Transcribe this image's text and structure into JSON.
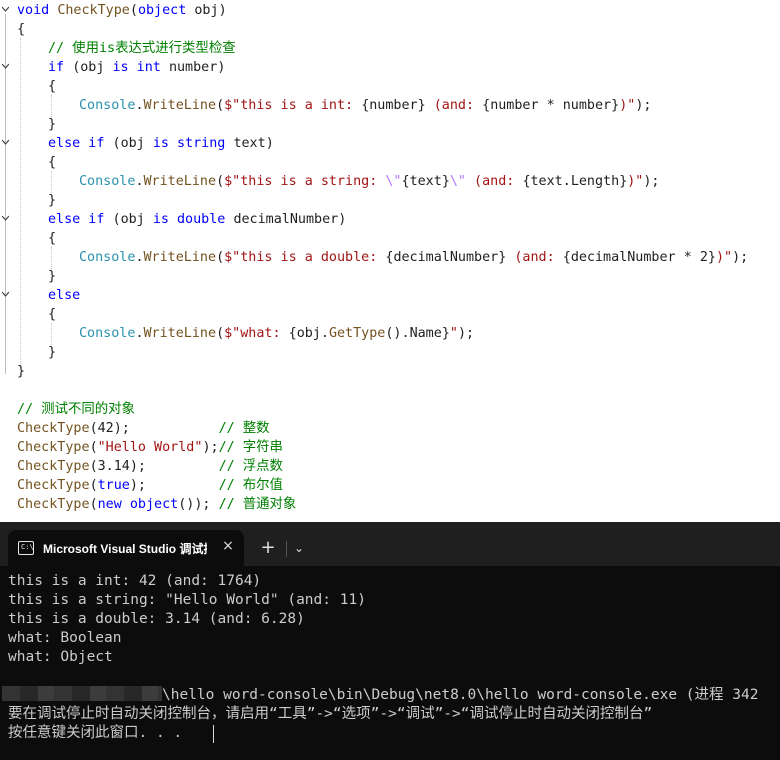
{
  "editor": {
    "lines": [
      [
        [
          "kw",
          "void "
        ],
        [
          "mth",
          "CheckType"
        ],
        [
          "pu",
          "("
        ],
        [
          "kw",
          "object "
        ],
        [
          "id",
          "obj"
        ],
        [
          "pu",
          ")"
        ]
      ],
      [
        [
          "pu",
          "{"
        ]
      ],
      [
        [
          "cm",
          "// 使用is表达式进行类型检查"
        ]
      ],
      [
        [
          "kw",
          "if "
        ],
        [
          "pu",
          "("
        ],
        [
          "id",
          "obj "
        ],
        [
          "kw",
          "is int "
        ],
        [
          "id",
          "number"
        ],
        [
          "pu",
          ")"
        ]
      ],
      [
        [
          "pu",
          "{"
        ]
      ],
      [
        [
          "ty",
          "Console"
        ],
        [
          "pu",
          "."
        ],
        [
          "mth",
          "WriteLine"
        ],
        [
          "pu",
          "("
        ],
        [
          "str",
          "$\"this is a int: "
        ],
        [
          "pu",
          "{"
        ],
        [
          "id",
          "number"
        ],
        [
          "pu",
          "}"
        ],
        [
          "str",
          " (and: "
        ],
        [
          "pu",
          "{"
        ],
        [
          "id",
          "number "
        ],
        [
          "pu",
          "* "
        ],
        [
          "id",
          "number"
        ],
        [
          "pu",
          "}"
        ],
        [
          "str",
          ")\""
        ],
        [
          "pu",
          ");"
        ]
      ],
      [
        [
          "pu",
          "}"
        ]
      ],
      [
        [
          "kw",
          "else if "
        ],
        [
          "pu",
          "("
        ],
        [
          "id",
          "obj "
        ],
        [
          "kw",
          "is string "
        ],
        [
          "id",
          "text"
        ],
        [
          "pu",
          ")"
        ]
      ],
      [
        [
          "pu",
          "{"
        ]
      ],
      [
        [
          "ty",
          "Console"
        ],
        [
          "pu",
          "."
        ],
        [
          "mth",
          "WriteLine"
        ],
        [
          "pu",
          "("
        ],
        [
          "str",
          "$\"this is a string: "
        ],
        [
          "esc",
          "\\\""
        ],
        [
          "pu",
          "{"
        ],
        [
          "id",
          "text"
        ],
        [
          "pu",
          "}"
        ],
        [
          "esc",
          "\\\""
        ],
        [
          "str",
          " (and: "
        ],
        [
          "pu",
          "{"
        ],
        [
          "id",
          "text"
        ],
        [
          "pu",
          "."
        ],
        [
          "id",
          "Length"
        ],
        [
          "pu",
          "}"
        ],
        [
          "str",
          ")\""
        ],
        [
          "pu",
          ");"
        ]
      ],
      [
        [
          "pu",
          "}"
        ]
      ],
      [
        [
          "kw",
          "else if "
        ],
        [
          "pu",
          "("
        ],
        [
          "id",
          "obj "
        ],
        [
          "kw",
          "is double "
        ],
        [
          "id",
          "decimalNumber"
        ],
        [
          "pu",
          ")"
        ]
      ],
      [
        [
          "pu",
          "{"
        ]
      ],
      [
        [
          "ty",
          "Console"
        ],
        [
          "pu",
          "."
        ],
        [
          "mth",
          "WriteLine"
        ],
        [
          "pu",
          "("
        ],
        [
          "str",
          "$\"this is a double: "
        ],
        [
          "pu",
          "{"
        ],
        [
          "id",
          "decimalNumber"
        ],
        [
          "pu",
          "}"
        ],
        [
          "str",
          " (and: "
        ],
        [
          "pu",
          "{"
        ],
        [
          "id",
          "decimalNumber "
        ],
        [
          "pu",
          "* "
        ],
        [
          "id",
          "2"
        ],
        [
          "pu",
          "}"
        ],
        [
          "str",
          ")\""
        ],
        [
          "pu",
          ");"
        ]
      ],
      [
        [
          "pu",
          "}"
        ]
      ],
      [
        [
          "kw",
          "else"
        ]
      ],
      [
        [
          "pu",
          "{"
        ]
      ],
      [
        [
          "ty",
          "Console"
        ],
        [
          "pu",
          "."
        ],
        [
          "mth",
          "WriteLine"
        ],
        [
          "pu",
          "("
        ],
        [
          "str",
          "$\"what: "
        ],
        [
          "pu",
          "{"
        ],
        [
          "id",
          "obj"
        ],
        [
          "pu",
          "."
        ],
        [
          "mth",
          "GetType"
        ],
        [
          "pu",
          "()."
        ],
        [
          "id",
          "Name"
        ],
        [
          "pu",
          "}"
        ],
        [
          "str",
          "\""
        ],
        [
          "pu",
          ");"
        ]
      ],
      [
        [
          "pu",
          "}"
        ]
      ],
      [
        [
          "pu",
          "}"
        ]
      ],
      [],
      [
        [
          "cm",
          "// 测试不同的对象"
        ]
      ],
      [
        [
          "mth",
          "CheckType"
        ],
        [
          "pu",
          "("
        ],
        [
          "id",
          "42"
        ],
        [
          "pu",
          ");           "
        ],
        [
          "cm",
          "// 整数"
        ]
      ],
      [
        [
          "mth",
          "CheckType"
        ],
        [
          "pu",
          "("
        ],
        [
          "str",
          "\"Hello World\""
        ],
        [
          "pu",
          ");"
        ],
        [
          "cm",
          "// 字符串"
        ]
      ],
      [
        [
          "mth",
          "CheckType"
        ],
        [
          "pu",
          "("
        ],
        [
          "id",
          "3.14"
        ],
        [
          "pu",
          ");         "
        ],
        [
          "cm",
          "// 浮点数"
        ]
      ],
      [
        [
          "mth",
          "CheckType"
        ],
        [
          "pu",
          "("
        ],
        [
          "kw",
          "true"
        ],
        [
          "pu",
          ");         "
        ],
        [
          "cm",
          "// 布尔值"
        ]
      ],
      [
        [
          "mth",
          "CheckType"
        ],
        [
          "pu",
          "("
        ],
        [
          "kw",
          "new object"
        ],
        [
          "pu",
          "()); "
        ],
        [
          "cm",
          "// 普通对象"
        ]
      ]
    ]
  },
  "console": {
    "tab": {
      "icon": "terminal-icon",
      "icon_text": "C:\\",
      "title": "Microsoft Visual Studio 调试控制台",
      "close_icon": "×",
      "new_tab_icon": "+",
      "dropdown_icon": "⌄"
    },
    "output": [
      "this is a int: 42 (and: 1764)",
      "this is a string: \"Hello World\" (and: 11)",
      "this is a double: 3.14 (and: 6.28)",
      "what: Boolean",
      "what: Object"
    ],
    "path_line": "\\hello word-console\\bin\\Debug\\net8.0\\hello word-console.exe (进程 342",
    "hint_line": "要在调试停止时自动关闭控制台，请启用“工具”->“选项”->“调试”->“调试停止时自动关闭控制台”",
    "press_key_line": "按任意键关闭此窗口. . ."
  }
}
